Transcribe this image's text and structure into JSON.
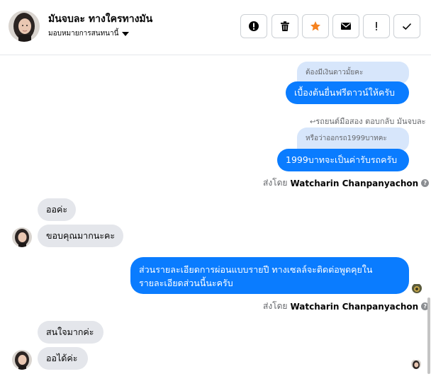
{
  "header": {
    "contact_name": "มันจบละ ทางใครทางมัน",
    "assign_label": "มอบหมายการสนทนานี้",
    "buttons": [
      {
        "name": "report-button",
        "icon": "alert-circle-icon"
      },
      {
        "name": "delete-button",
        "icon": "trash-icon"
      },
      {
        "name": "star-button",
        "icon": "star-icon",
        "color": "#f5821f"
      },
      {
        "name": "mark-unread-button",
        "icon": "envelope-icon"
      },
      {
        "name": "follow-up-button",
        "icon": "exclamation-icon"
      },
      {
        "name": "done-button",
        "icon": "check-icon"
      }
    ]
  },
  "messages": {
    "m1_quote": "ต้องมีเงินดาวมั้ยคะ",
    "m1_text": "เบื้องต้นยื่นฟรีดาวน์ให้ครับ",
    "m2_reply_meta": "รถยนต์มือสอง ตอบกลับ มันจบละ",
    "m2_quote": "หรือว่าออกรถ1999บาทคะ",
    "m2_text": "1999บาทจะเป็นค่ารับรถครับ",
    "m2_sender_prefix": "ส่งโดย",
    "m2_sender_name": "Watcharin Chanpanyachon",
    "m3_text": "ออค่ะ",
    "m4_text": "ขอบคุณมากนะคะ",
    "m5_line1": "ส่วนรายละเอียดการผ่อนแบบรายปี ทางเซลล์จะติดต่อพูดคุยใน",
    "m5_line2": "รายละเอียดส่วนนี้นะครับ",
    "m5_sender_prefix": "ส่งโดย",
    "m5_sender_name": "Watcharin Chanpanyachon",
    "m6_text": "สนใจมากค่ะ",
    "m7_text": "ออได้ค่ะ"
  },
  "colors": {
    "outgoing_bubble": "#0a7cff",
    "incoming_bubble": "#e4e6eb",
    "quote_bubble": "#d7e6fb",
    "star": "#f5821f"
  }
}
